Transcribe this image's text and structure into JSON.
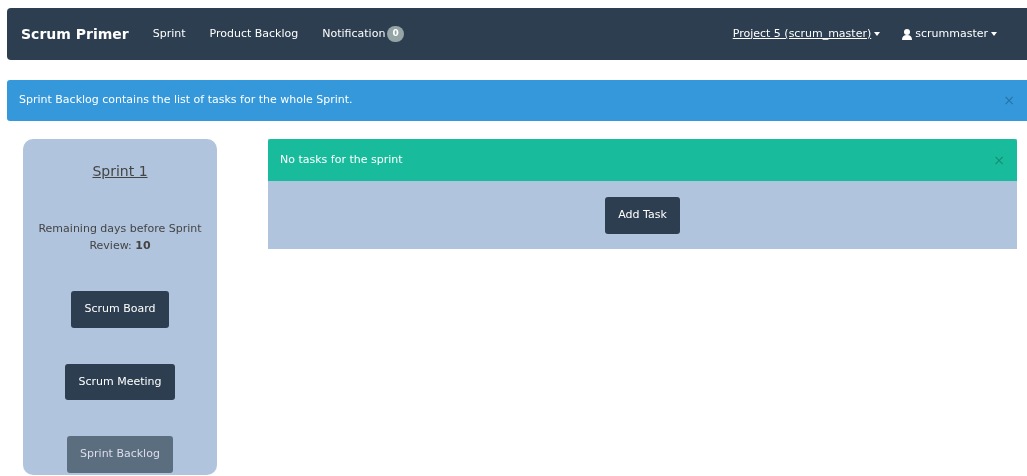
{
  "navbar": {
    "brand": "Scrum Primer",
    "links": [
      {
        "label": "Sprint"
      },
      {
        "label": "Product Backlog"
      },
      {
        "label": "Notification",
        "badge": "0"
      }
    ],
    "right": [
      {
        "label": "Project 5 (scrum_master)",
        "kind": "dropdown",
        "underlined": true
      },
      {
        "label": "scrummaster",
        "kind": "user"
      }
    ]
  },
  "info_alert": {
    "text": "Sprint Backlog contains the list of tasks for the whole Sprint.",
    "close": "×"
  },
  "sidebar": {
    "title": "Sprint 1",
    "remaining_label": "Remaining days before Sprint Review:",
    "remaining_days": "10",
    "buttons": [
      {
        "label": "Scrum Board",
        "disabled": false
      },
      {
        "label": "Scrum Meeting",
        "disabled": false
      },
      {
        "label": "Sprint Backlog",
        "disabled": true
      }
    ]
  },
  "tasks": {
    "alert": {
      "text": "No tasks for the sprint",
      "close": "×"
    },
    "button": "Add Task"
  }
}
